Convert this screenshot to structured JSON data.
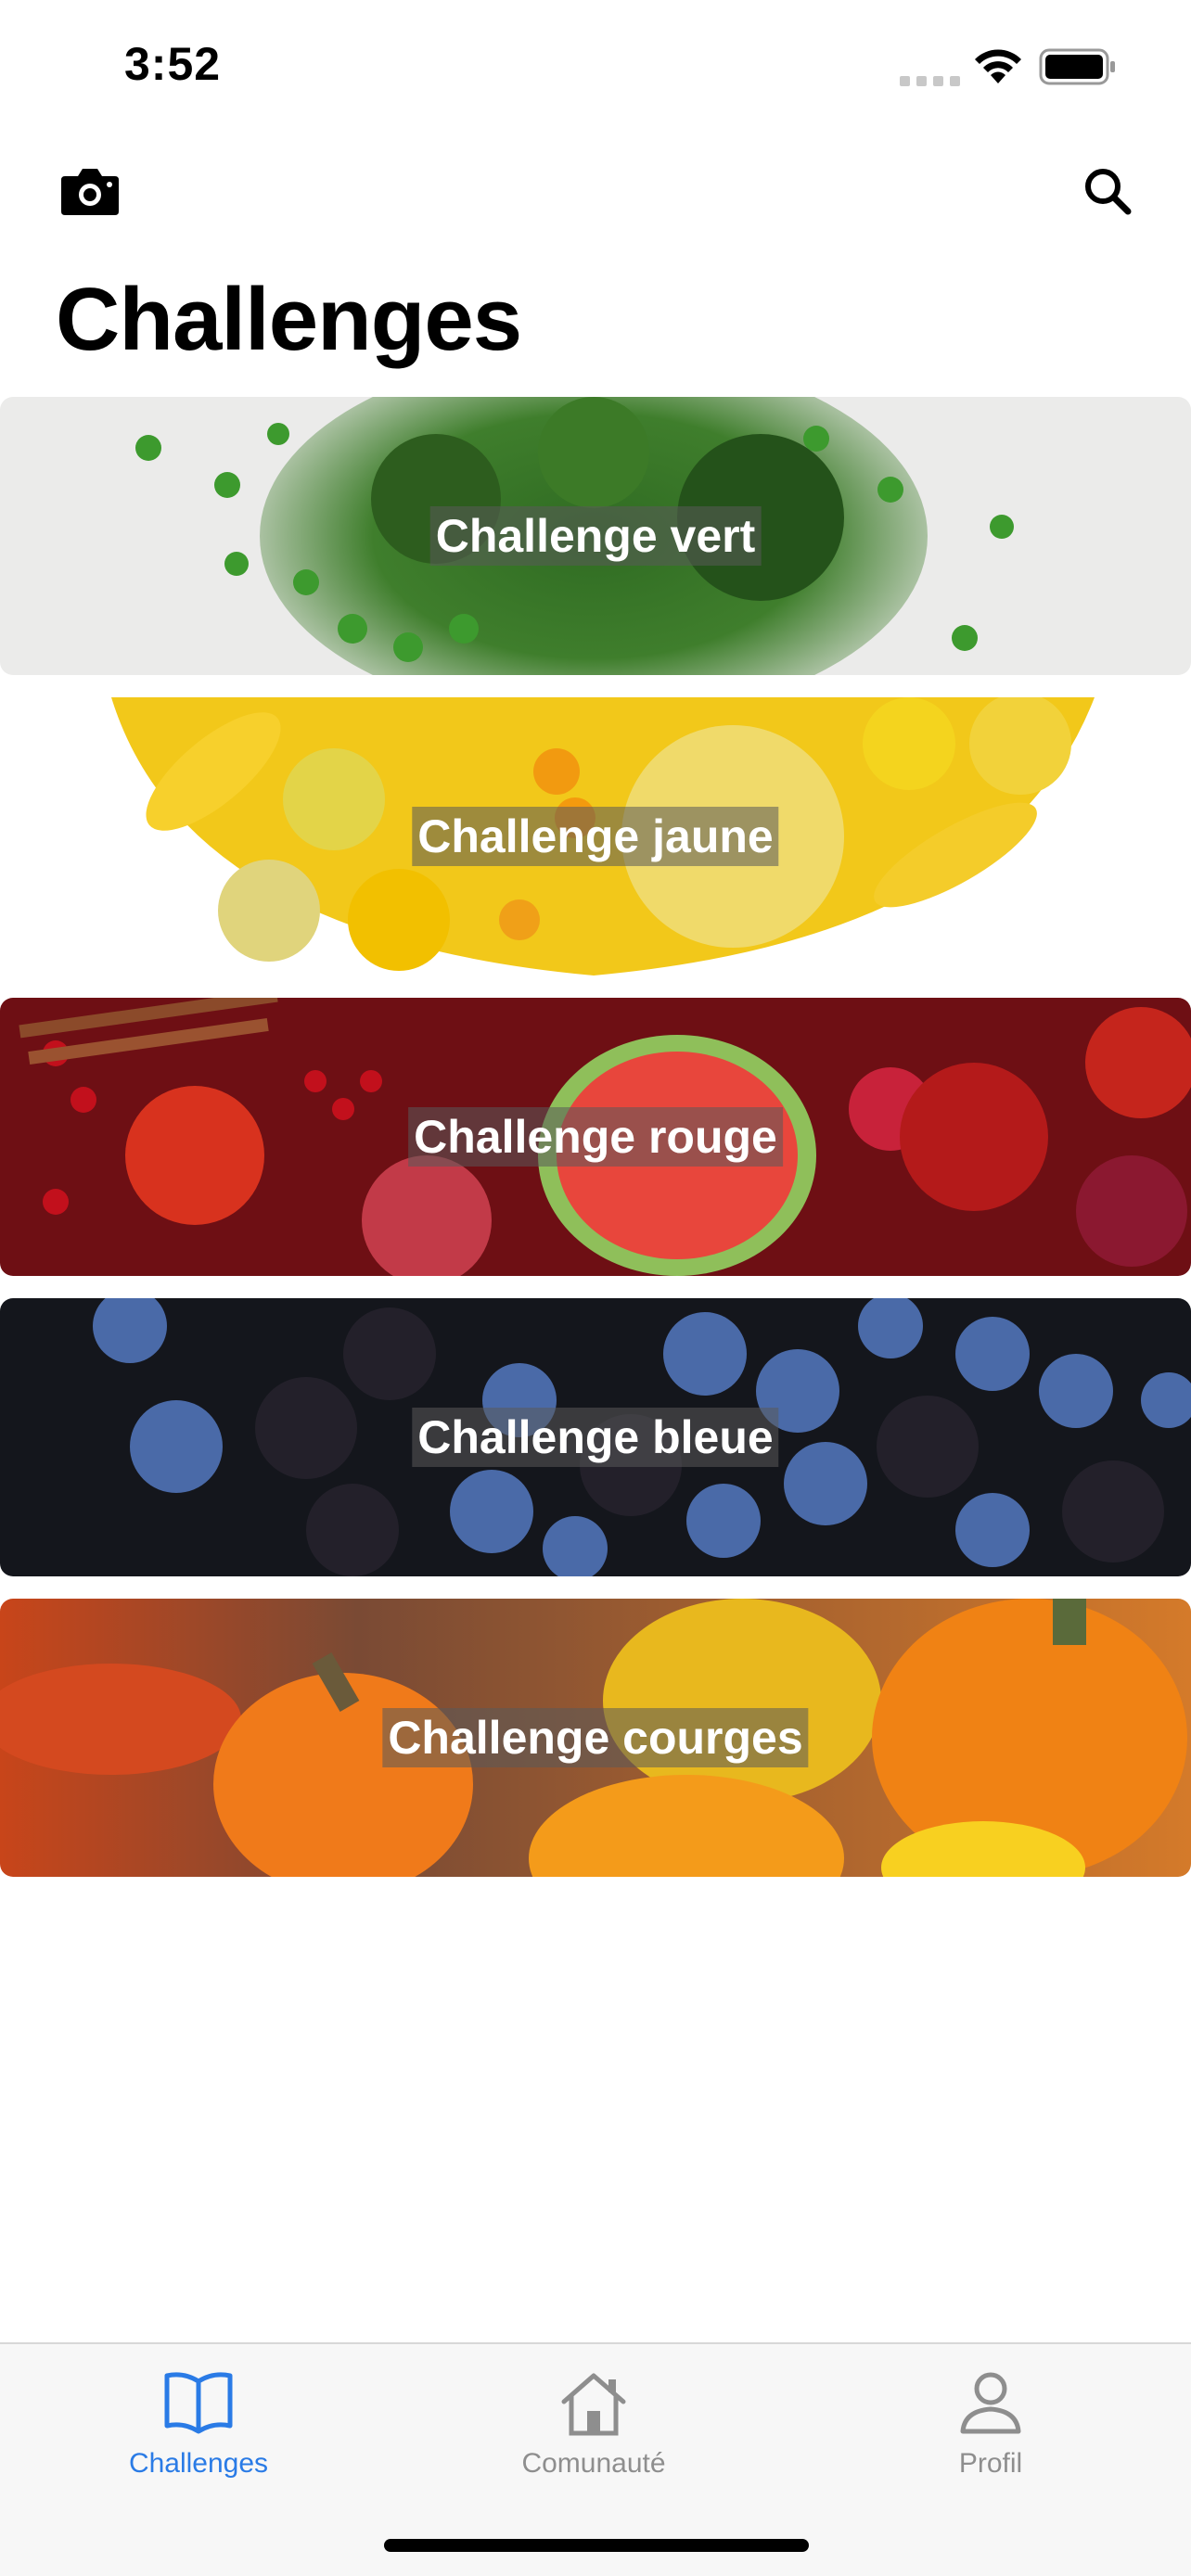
{
  "status_bar": {
    "time": "3:52"
  },
  "header": {
    "title": "Challenges",
    "left_icon": "camera-icon",
    "right_icon": "search-icon"
  },
  "challenges": [
    {
      "label": "Challenge vert"
    },
    {
      "label": "Challenge jaune"
    },
    {
      "label": "Challenge rouge"
    },
    {
      "label": "Challenge bleue"
    },
    {
      "label": "Challenge courges"
    }
  ],
  "tab_bar": {
    "tabs": [
      {
        "label": "Challenges",
        "icon": "book-icon",
        "active": true
      },
      {
        "label": "Comunauté",
        "icon": "house-icon",
        "active": false
      },
      {
        "label": "Profil",
        "icon": "person-icon",
        "active": false
      }
    ]
  },
  "colors": {
    "accent": "#2a7be6",
    "inactive": "#8e8e8e"
  }
}
